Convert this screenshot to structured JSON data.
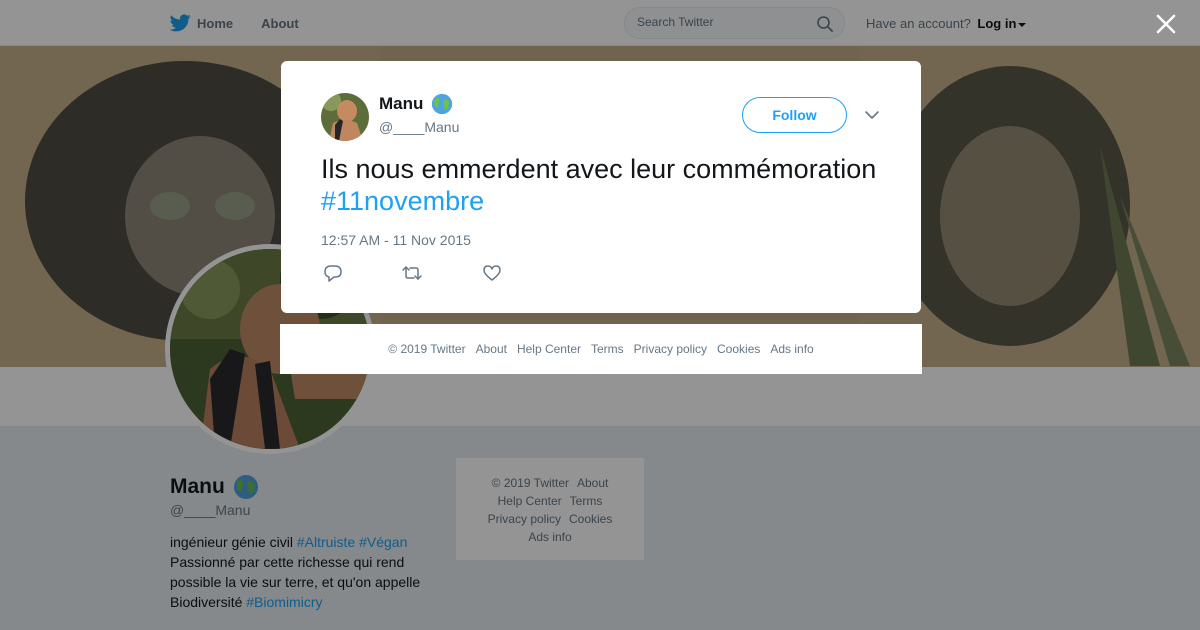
{
  "nav": {
    "home_label": "Home",
    "about_label": "About",
    "search_placeholder": "Search Twitter",
    "account_prompt": "Have an account?",
    "login_label": "Log in"
  },
  "profile": {
    "name": "Manu",
    "handle": "@____Manu",
    "bio_text_1": "ingénieur génie civil ",
    "bio_tag_1": "#Altruiste",
    "bio_tag_2": "#Végan",
    "bio_text_2": "Passionné par cette richesse qui rend possible la vie sur terre, et qu'on appelle Biodiversité ",
    "bio_tag_3": "#Biomimicry"
  },
  "side_footer": {
    "copyright": "© 2019 Twitter",
    "about": "About",
    "help": "Help Center",
    "terms": "Terms",
    "privacy": "Privacy policy",
    "cookies": "Cookies",
    "ads": "Ads info"
  },
  "tweet": {
    "author_name": "Manu",
    "author_handle": "@____Manu",
    "follow_label": "Follow",
    "text": "Ils nous emmerdent avec leur commémoration ",
    "hashtag": "#11novembre",
    "timestamp": "12:57 AM - 11 Nov 2015"
  },
  "modal_footer": {
    "copyright": "© 2019 Twitter",
    "about": "About",
    "help": "Help Center",
    "terms": "Terms",
    "privacy": "Privacy policy",
    "cookies": "Cookies",
    "ads": "Ads info"
  },
  "icons": {
    "bird": "twitter-bird-icon",
    "search": "search-icon",
    "close": "close-icon",
    "chevron": "chevron-down-icon",
    "reply": "reply-icon",
    "retweet": "retweet-icon",
    "like": "heart-icon",
    "globe": "globe-emoji-icon"
  },
  "colors": {
    "brand": "#1da1f2",
    "text": "#14171a",
    "muted": "#657786",
    "overlay": "rgba(0,0,0,0.42)"
  }
}
